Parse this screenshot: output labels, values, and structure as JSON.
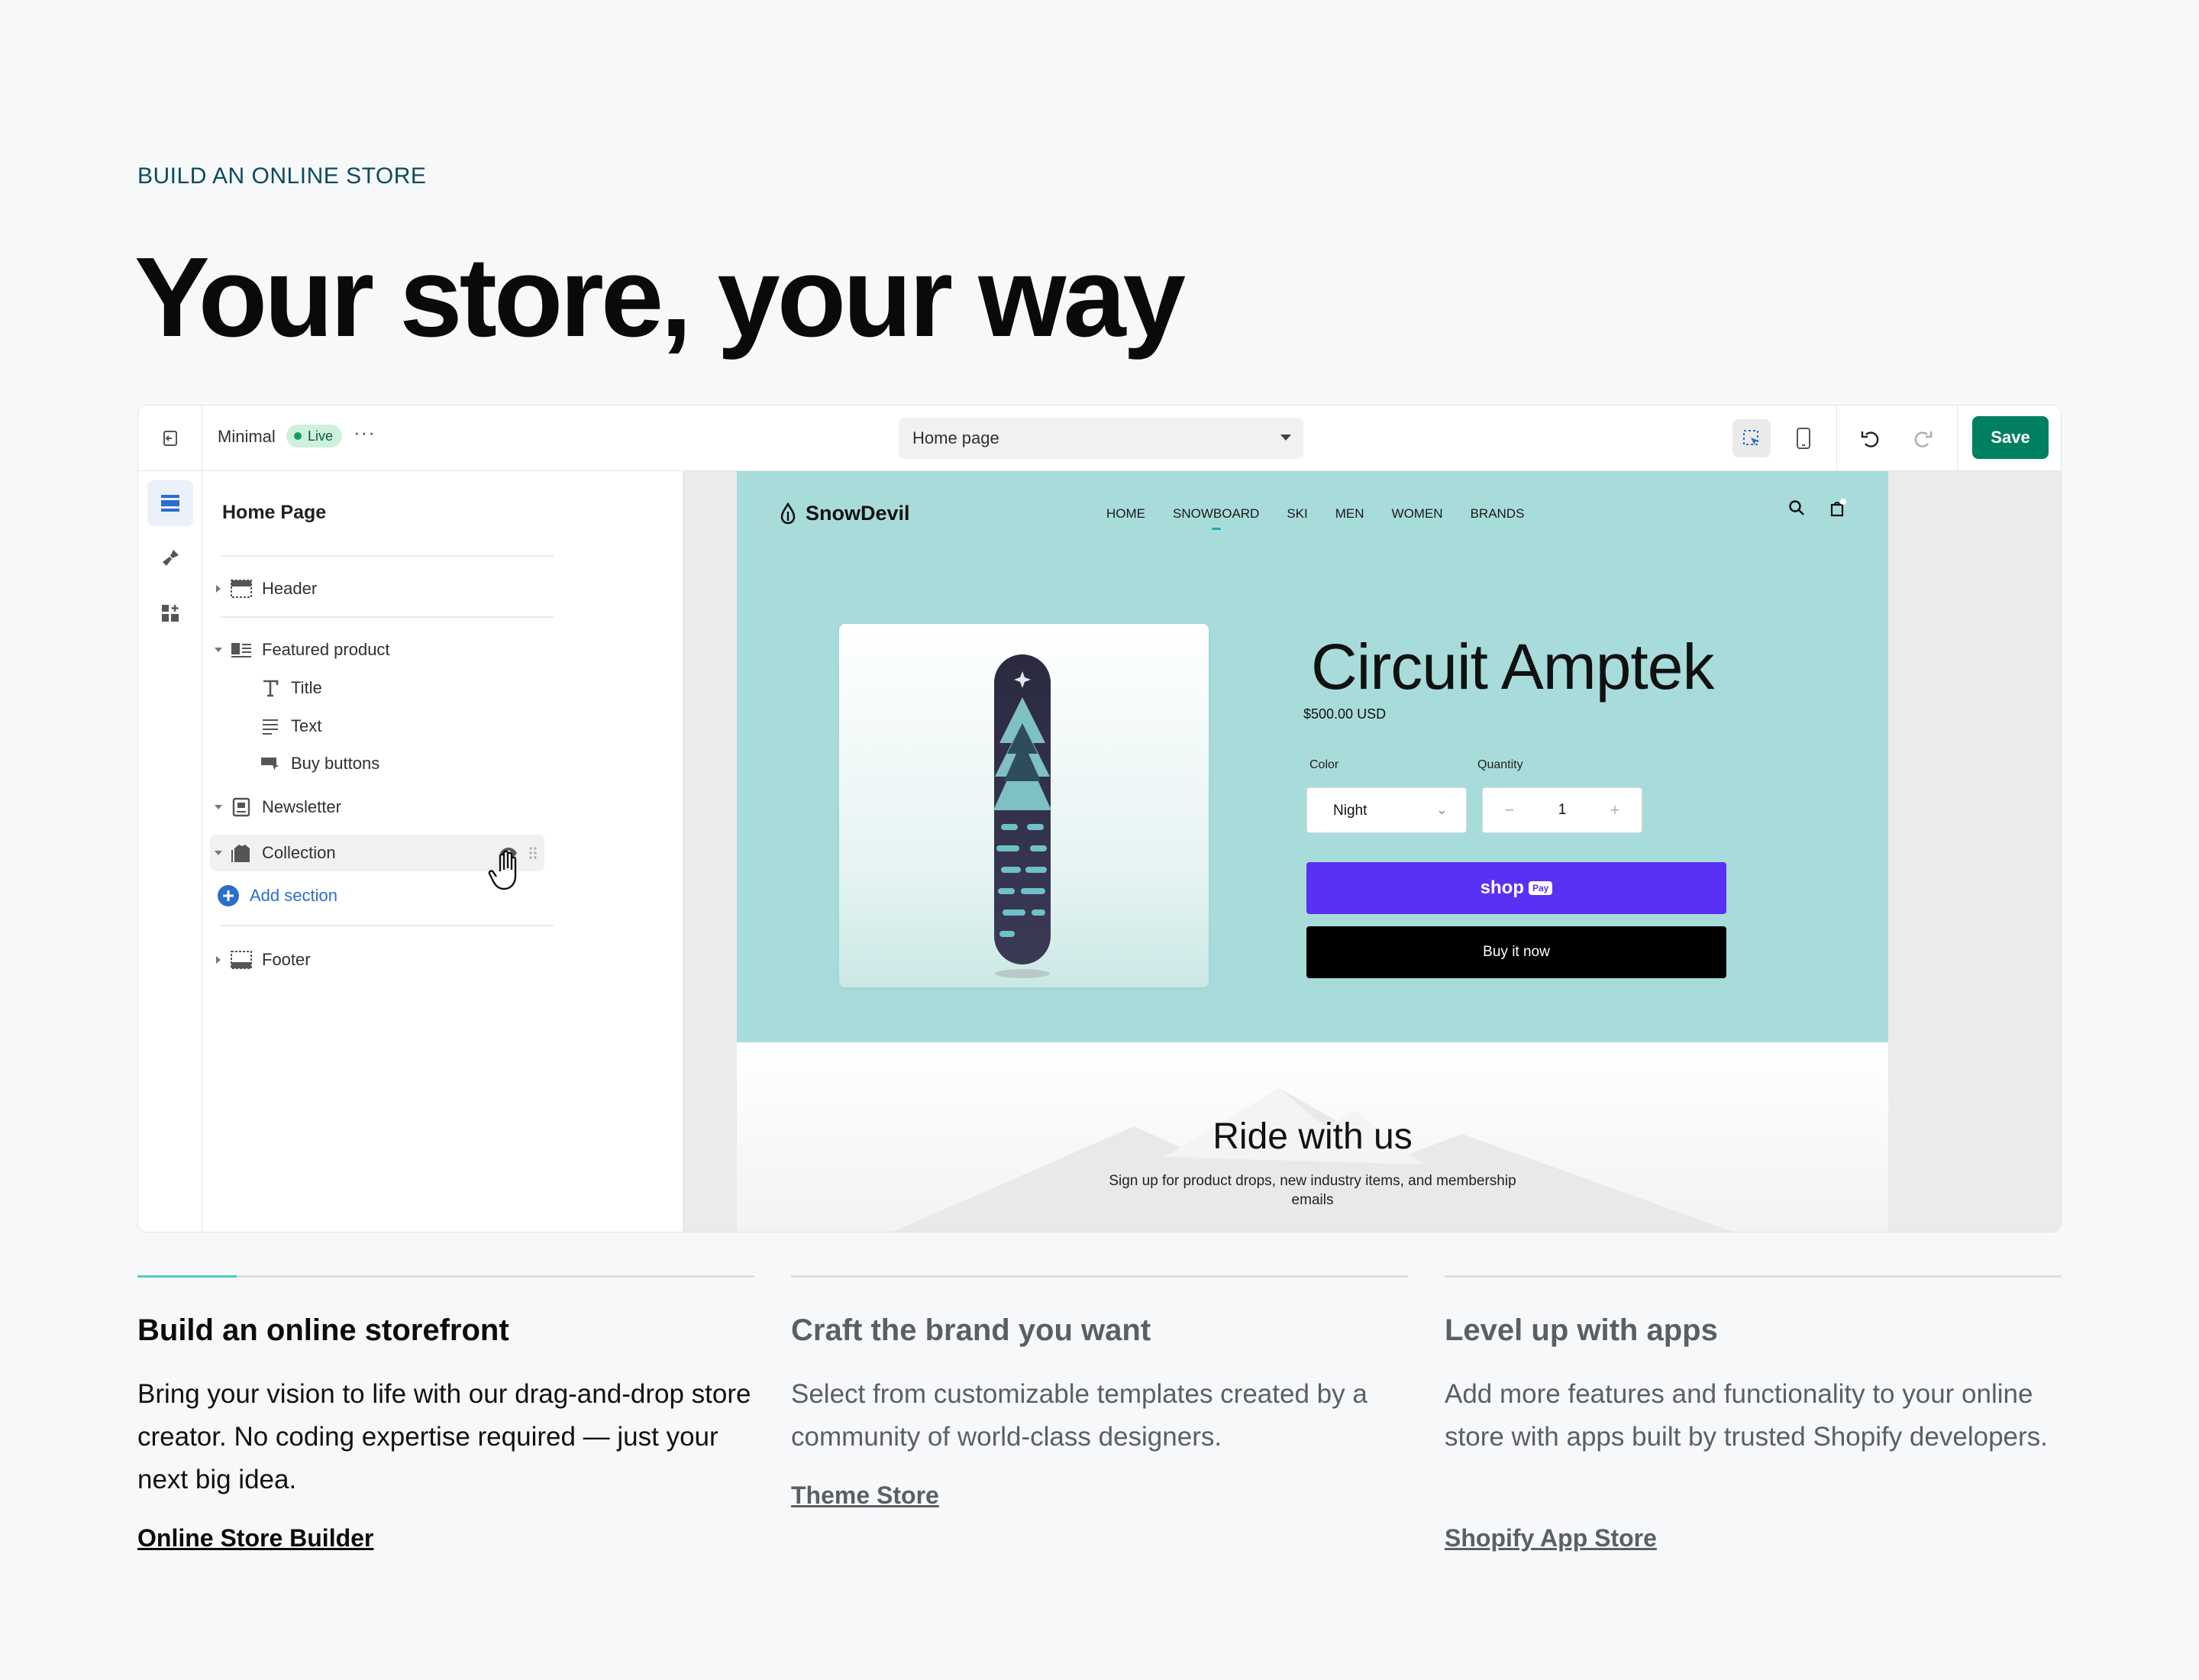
{
  "eyebrow": "BUILD AN ONLINE STORE",
  "headline": "Your store, your way",
  "editor": {
    "theme_name": "Minimal",
    "live_badge": "Live",
    "more": "···",
    "page_select": "Home page",
    "save_label": "Save",
    "sidebar": {
      "title": "Home Page",
      "sections": {
        "header": "Header",
        "featured_product": "Featured product",
        "title_block": "Title",
        "text_block": "Text",
        "buy_buttons": "Buy buttons",
        "newsletter": "Newsletter",
        "collection": "Collection",
        "add_section": "Add section",
        "footer": "Footer"
      }
    },
    "store": {
      "logo": "SnowDevil",
      "nav": [
        "HOME",
        "SNOWBOARD",
        "SKI",
        "MEN",
        "WOMEN",
        "BRANDS"
      ],
      "product_name": "Circuit Amptek",
      "price": "$500.00 USD",
      "color_label": "Color",
      "color_value": "Night",
      "quantity_label": "Quantity",
      "quantity_value": "1",
      "minus": "−",
      "plus": "+",
      "shop_label": "shop",
      "shop_pay_badge": "Pay",
      "buy_now": "Buy it now",
      "ride_title": "Ride with us",
      "ride_subtitle": "Sign up for product drops, new industry items, and membership emails"
    },
    "colors": {
      "save_green": "#008060",
      "hero_teal": "#a8dcdb",
      "shop_pay_purple": "#5a31f4",
      "live_green": "#cdf1dc",
      "accent_teal": "#4fc9c0"
    }
  },
  "features": [
    {
      "title": "Build an online storefront",
      "body": "Bring your vision to life with our drag-and-drop store creator. No coding expertise required — just your next big idea.",
      "link": "Online Store Builder"
    },
    {
      "title": "Craft the brand you want",
      "body": "Select from customizable templates created by a community of world-class designers.",
      "link": "Theme Store"
    },
    {
      "title": "Level up with apps",
      "body": "Add more features and functionality to your online store with apps built by trusted Shopify developers.",
      "link": "Shopify App Store"
    }
  ]
}
